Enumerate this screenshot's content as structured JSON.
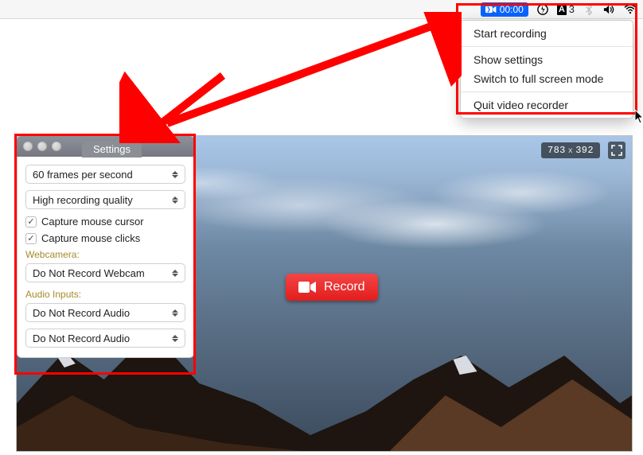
{
  "menubar": {
    "rec_timer": "00:00",
    "adobe_label": "A",
    "number": "3"
  },
  "dropdown": {
    "start": "Start recording",
    "show_settings": "Show settings",
    "fullscreen": "Switch to full screen mode",
    "quit": "Quit video recorder"
  },
  "recorder": {
    "dims_w": "783",
    "dims_h": "392",
    "record_label": "Record"
  },
  "settings": {
    "title": "Settings",
    "fps": "60 frames per second",
    "quality": "High recording quality",
    "capture_cursor": "Capture mouse cursor",
    "capture_clicks": "Capture mouse clicks",
    "webcam_label": "Webcamera:",
    "webcam_value": "Do Not Record Webcam",
    "audio_label": "Audio Inputs:",
    "audio1": "Do Not Record Audio",
    "audio2": "Do Not Record Audio"
  }
}
